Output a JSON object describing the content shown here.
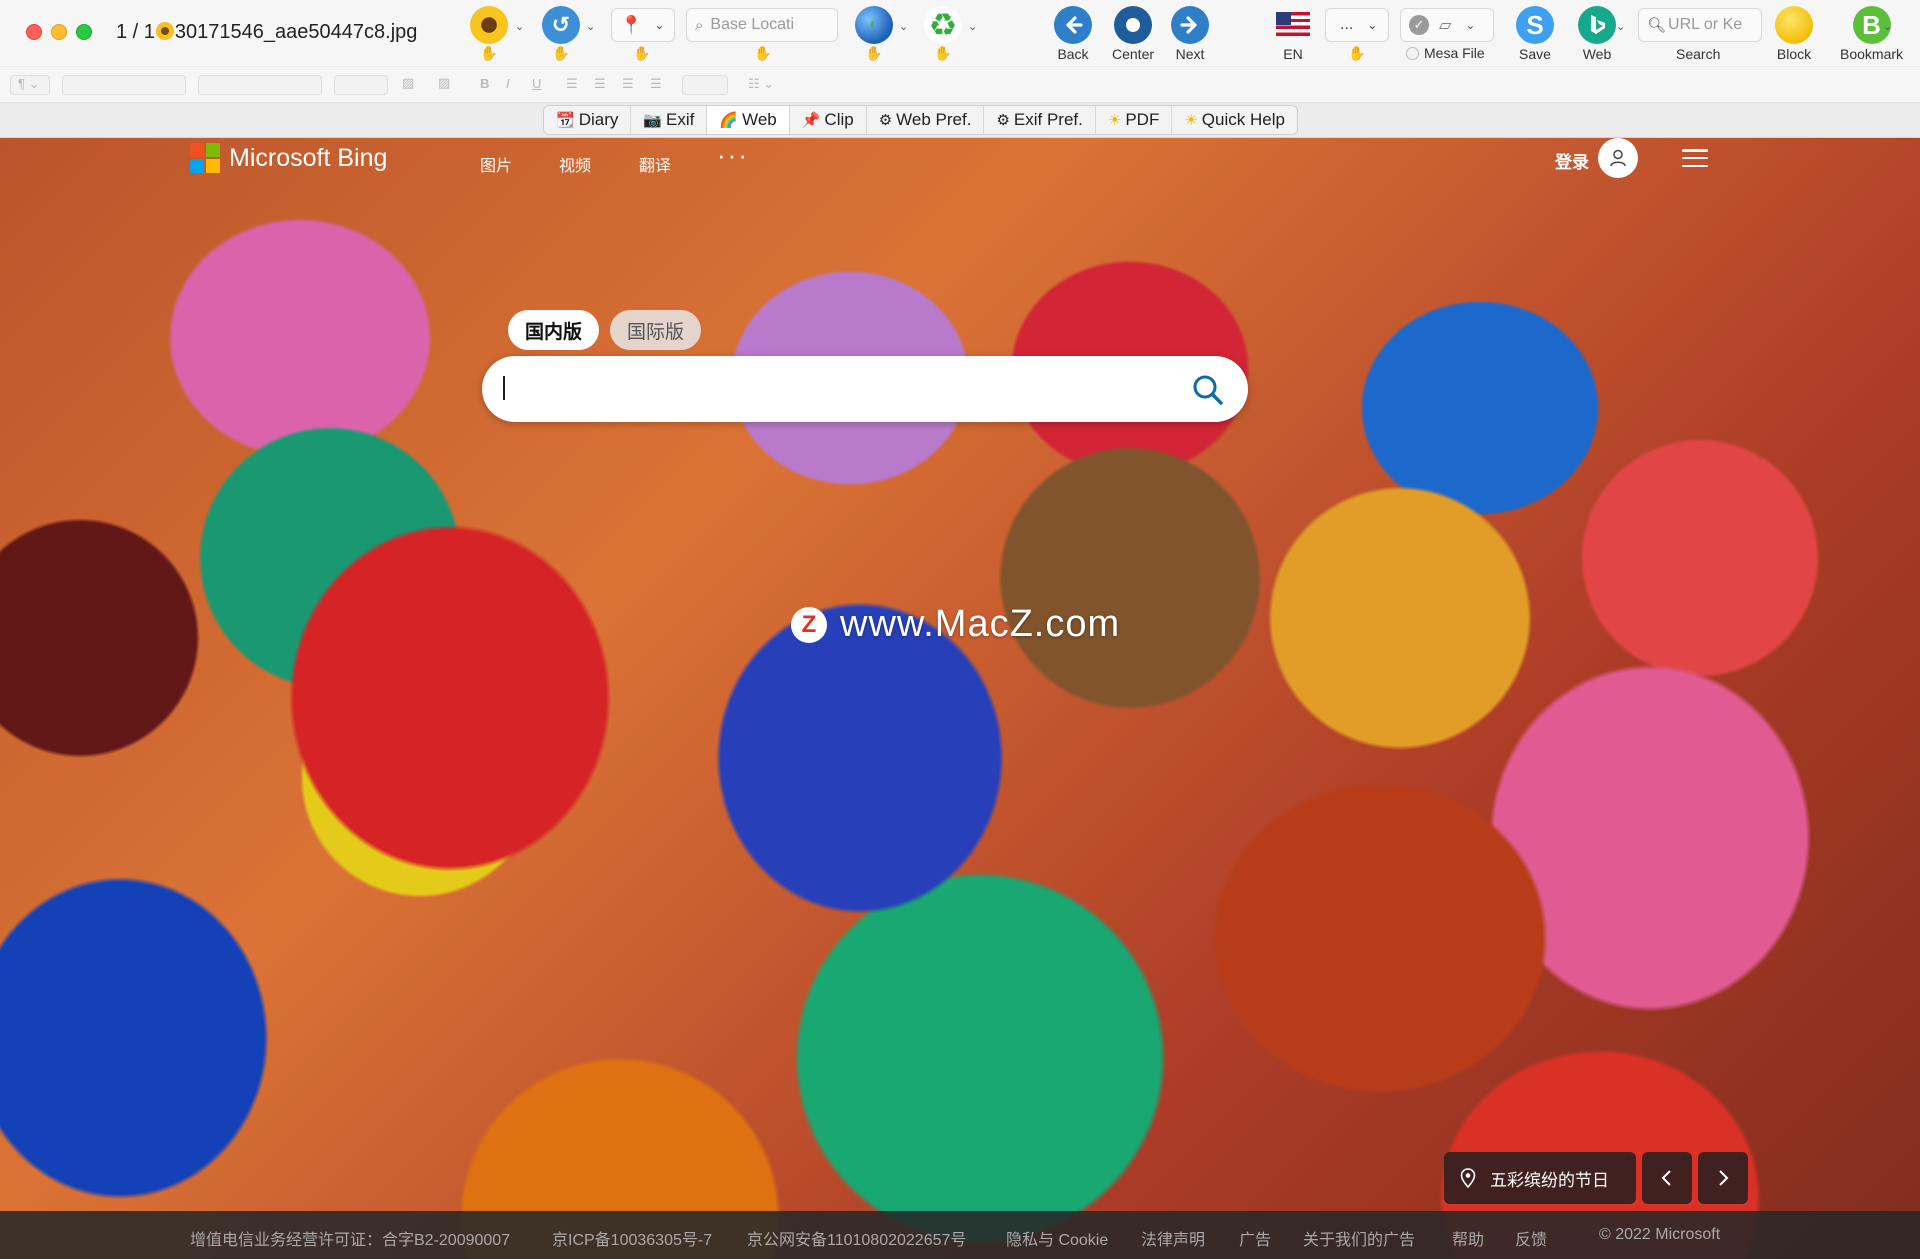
{
  "window": {
    "title_prefix": "1 / 1",
    "title_file": "30171546_aae50447c8.jpg",
    "title_icon": "sunflower-icon"
  },
  "toolbar": {
    "location_placeholder": "Base Locati",
    "url_placeholder": "URL or Ke",
    "flag_icon": "us-flag-icon",
    "dots_label": "...",
    "buttons": {
      "back": "Back",
      "center": "Center",
      "next": "Next",
      "lang": "EN",
      "mesa": "Mesa File",
      "save": "Save",
      "web": "Web",
      "search": "Search",
      "block": "Block",
      "bookmark": "Bookmark"
    },
    "colors": {
      "back": "#2f7fc8",
      "center": "#1f5d9a",
      "next": "#2f7fc8",
      "save": "#3da0f0",
      "web": "#17a98c",
      "block": "#f4c20d",
      "bookmark": "#5cbf3a"
    }
  },
  "tabs": [
    {
      "label": "Diary",
      "icon": "calendar-icon"
    },
    {
      "label": "Exif",
      "icon": "camera-icon"
    },
    {
      "label": "Web",
      "icon": "rainbow-icon",
      "active": true
    },
    {
      "label": "Clip",
      "icon": "pin-icon"
    },
    {
      "label": "Web Pref.",
      "icon": "gear-icon"
    },
    {
      "label": "Exif Pref.",
      "icon": "gear-icon"
    },
    {
      "label": "PDF",
      "icon": "sun-icon"
    },
    {
      "label": "Quick Help",
      "icon": "sun-icon"
    }
  ],
  "bing": {
    "brand": "Microsoft Bing",
    "logo_colors": [
      "#f25022",
      "#7fba00",
      "#00a4ef",
      "#ffb900"
    ],
    "nav": [
      "图片",
      "视频",
      "翻译"
    ],
    "more": "···",
    "login": "登录",
    "region_domestic": "国内版",
    "region_intl": "国际版",
    "search_value": "",
    "accent": "#0c6aa8"
  },
  "watermark": {
    "mark": "Z",
    "text": "www.MacZ.com"
  },
  "caption": {
    "text": "五彩缤纷的节日"
  },
  "footer": {
    "icp_license": "增值电信业务经营许可证：合字B2-20090007",
    "icp_record": "京ICP备10036305号-7",
    "police_record": "京公网安备11010802022657号",
    "privacy": "隐私与 Cookie",
    "legal": "法律声明",
    "ads": "广告",
    "about_ads": "关于我们的广告",
    "help": "帮助",
    "feedback": "反馈",
    "copyright": "© 2022 Microsoft"
  }
}
